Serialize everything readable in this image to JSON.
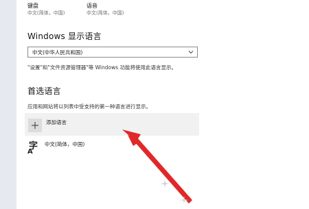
{
  "tiles": [
    {
      "title": "键盘",
      "subtitle": "中文(简体，中国)"
    },
    {
      "title": "语音",
      "subtitle": "中文(简体，中国)"
    }
  ],
  "display_language": {
    "title": "Windows 显示语言",
    "selected": "中文(中华人民共和国)",
    "description": "\"设置\"和\"文件资源管理器\"等 Windows 功能将使用此语言显示。"
  },
  "preferred": {
    "title": "首选语言",
    "description": "应用和网站将以列表中受支持的第一种语言进行显示。",
    "add_label": "添加语言",
    "languages": [
      {
        "name": "中文(简体，中国)"
      }
    ]
  },
  "annotation": {
    "arrow_color": "#e0282a"
  }
}
